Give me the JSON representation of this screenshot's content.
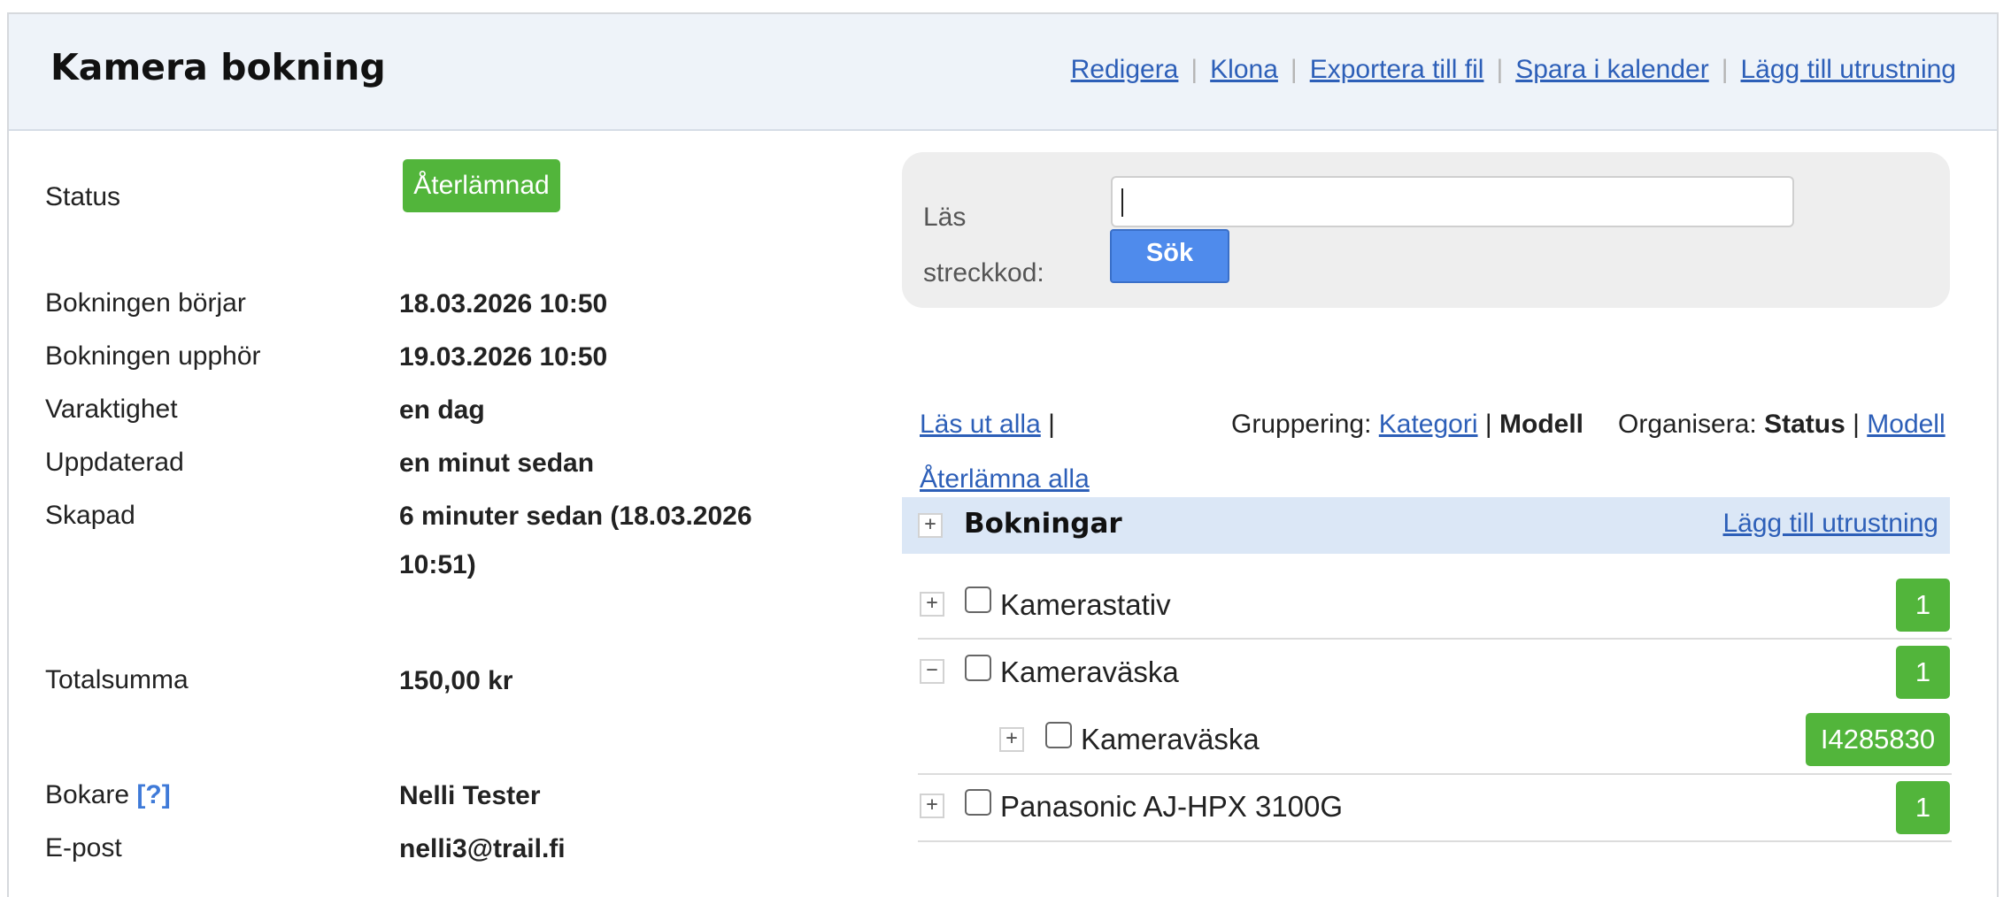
{
  "header": {
    "title": "Kamera bokning",
    "actions": [
      "Redigera",
      "Klona",
      "Exportera till fil",
      "Spara i kalender",
      "Lägg till utrustning"
    ]
  },
  "info": {
    "status_label": "Status",
    "status_value": "Återlämnad",
    "start_label": "Bokningen börjar",
    "start_value": "18.03.2026 10:50",
    "end_label": "Bokningen upphör",
    "end_value": "19.03.2026 10:50",
    "duration_label": "Varaktighet",
    "duration_value": "en dag",
    "updated_label": "Uppdaterad",
    "updated_value": "en minut sedan",
    "created_label": "Skapad",
    "created_value": "6 minuter sedan (18.03.2026 10:51)",
    "total_label": "Totalsumma",
    "total_value": "150,00 kr",
    "booker_label": "Bokare",
    "booker_help": "[?]",
    "booker_value": "Nelli Tester",
    "email_label": "E-post",
    "email_value": "nelli3@trail.fi"
  },
  "scan": {
    "label": "Läs streckkod:",
    "input_value": "",
    "button": "Sök"
  },
  "toolbar": {
    "checkout_all": "Läs ut alla",
    "pipe": "|",
    "return_all": "Återlämna alla",
    "grouping_label": "Gruppering:",
    "grouping_category": "Kategori",
    "grouping_model": "Modell",
    "organize_label": "Organisera:",
    "organize_status": "Status",
    "organize_model": "Modell"
  },
  "bookings": {
    "title": "Bokningar",
    "add_link": "Lägg till utrustning",
    "items": [
      {
        "name": "Kamerastativ",
        "count": "1",
        "toggle": "+"
      },
      {
        "name": "Kameraväska",
        "count": "1",
        "toggle": "−"
      },
      {
        "name": "Kameraväska",
        "count": "I4285830",
        "toggle": "+"
      },
      {
        "name": "Panasonic AJ-HPX 3100G",
        "count": "1",
        "toggle": "+"
      }
    ]
  },
  "colors": {
    "header_bg": "#eef3f9",
    "badge_green": "#52b53b",
    "link_blue": "#2d5fb8",
    "button_blue": "#4f8bec",
    "group_bg": "#dbe7f6"
  }
}
